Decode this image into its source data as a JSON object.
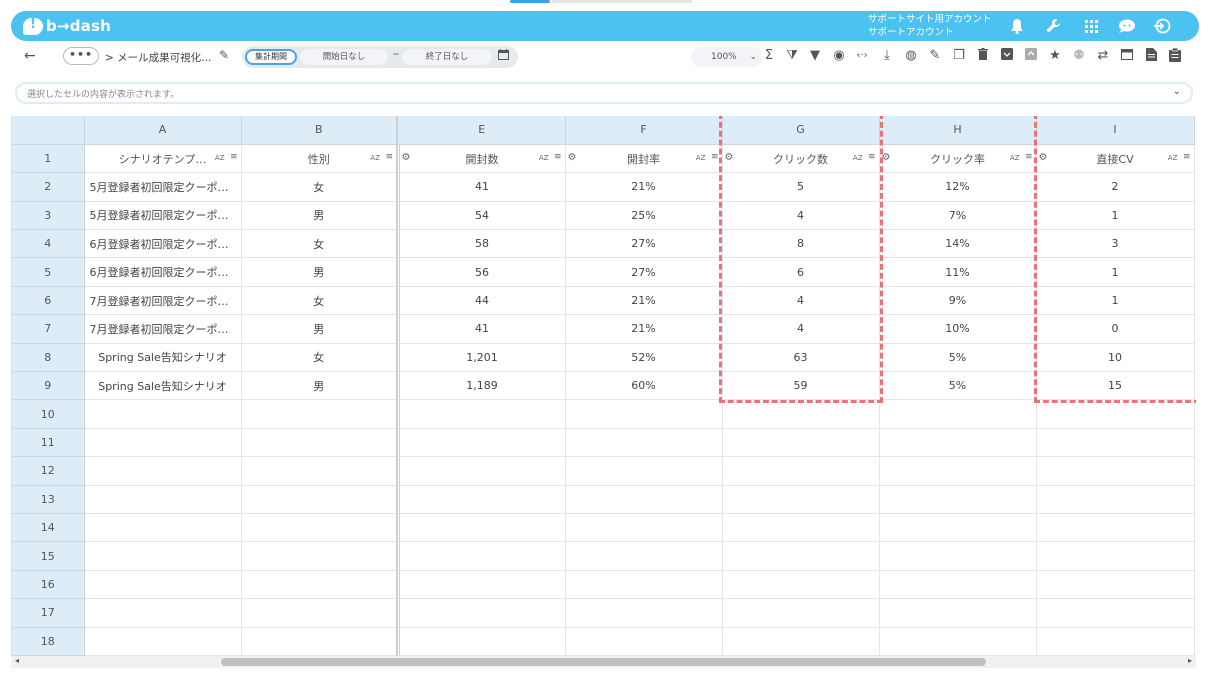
{
  "header": {
    "logo_text": "b→dash",
    "account_line1": "サポートサイト用アカウント",
    "account_line2": "サポートアカウント"
  },
  "toolbar": {
    "back": "←",
    "more": "•••",
    "breadcrumb": "> メール成果可視化…",
    "period_label": "集計期間",
    "start_date": "開始日なし",
    "tilde": "~",
    "end_date": "終了日なし",
    "zoom": "100%"
  },
  "infobar": {
    "placeholder": "選択したセルの内容が表示されます。"
  },
  "grid": {
    "columns": [
      "A",
      "B",
      "E",
      "F",
      "G",
      "H",
      "I"
    ],
    "headers": [
      "シナリオテンプ…",
      "性別",
      "開封数",
      "開封率",
      "クリック数",
      "クリック率",
      "直接CV"
    ],
    "az": "AZ",
    "rows": [
      [
        "5月登録者初回限定クーポ…",
        "女",
        "41",
        "21%",
        "5",
        "12%",
        "2"
      ],
      [
        "5月登録者初回限定クーポ…",
        "男",
        "54",
        "25%",
        "4",
        "7%",
        "1"
      ],
      [
        "6月登録者初回限定クーポ…",
        "女",
        "58",
        "27%",
        "8",
        "14%",
        "3"
      ],
      [
        "6月登録者初回限定クーポ…",
        "男",
        "56",
        "27%",
        "6",
        "11%",
        "1"
      ],
      [
        "7月登録者初回限定クーポ…",
        "女",
        "44",
        "21%",
        "4",
        "9%",
        "1"
      ],
      [
        "7月登録者初回限定クーポ…",
        "男",
        "41",
        "21%",
        "4",
        "10%",
        "0"
      ],
      [
        "Spring Sale告知シナリオ",
        "女",
        "1,201",
        "52%",
        "63",
        "5%",
        "10"
      ],
      [
        "Spring Sale告知シナリオ",
        "男",
        "1,189",
        "60%",
        "59",
        "5%",
        "15"
      ]
    ],
    "row_numbers": [
      "1",
      "2",
      "3",
      "4",
      "5",
      "6",
      "7",
      "8",
      "9",
      "10",
      "11",
      "12",
      "13",
      "14",
      "15",
      "16",
      "17",
      "18"
    ]
  },
  "colors": {
    "header_bg": "#4cc2f1",
    "grid_header_bg": "#deecf8",
    "highlight": "#e8747a"
  }
}
